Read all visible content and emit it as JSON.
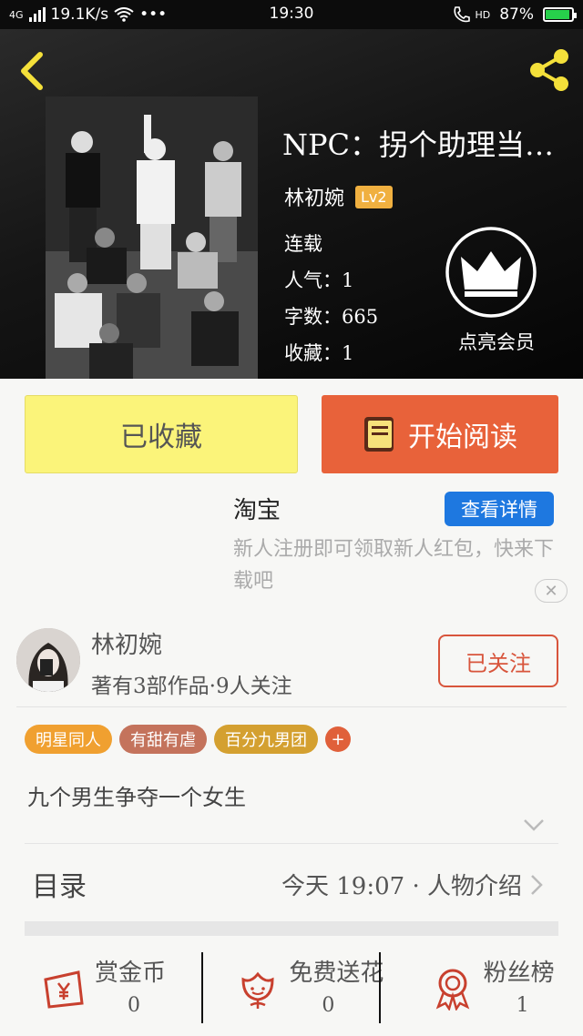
{
  "status_bar": {
    "network": "4G",
    "speed": "19.1K/s",
    "dots": "•••",
    "time": "19:30",
    "hd": "HD",
    "battery": "87%"
  },
  "book": {
    "title": "NPC：拐个助理当…",
    "author": "林初婉",
    "author_level": "Lv2",
    "status": "连载",
    "popularity": "人气：1",
    "word_count": "字数：665",
    "favorites": "收藏：1",
    "vip_label": "点亮会员"
  },
  "actions": {
    "collected_label": "已收藏",
    "read_label": "开始阅读"
  },
  "ad": {
    "title": "淘宝",
    "button": "查看详情",
    "description": "新人注册即可领取新人红包，快来下载吧",
    "close": "✕"
  },
  "author_card": {
    "name": "林初婉",
    "info": "著有3部作品·9人关注",
    "follow_label": "已关注"
  },
  "tags": [
    {
      "label": "明星同人",
      "color": "#f0a030"
    },
    {
      "label": "有甜有虐",
      "color": "#c4735c"
    },
    {
      "label": "百分九男团",
      "color": "#d4a030"
    }
  ],
  "tag_add": "+",
  "summary": "九个男生争夺一个女生",
  "catalog": {
    "label": "目录",
    "latest": "今天 19:07 · 人物介绍"
  },
  "bottom_bar": [
    {
      "icon": "coin-reward-icon",
      "label": "赏金币",
      "count": "0"
    },
    {
      "icon": "flower-icon",
      "label": "免费送花",
      "count": "0"
    },
    {
      "icon": "medal-ribbon-icon",
      "label": "粉丝榜",
      "count": "1"
    }
  ],
  "colors": {
    "accent_orange": "#e8623a",
    "collected_yellow": "#fbf47a",
    "ad_blue": "#1e78e0",
    "follow_red": "#d8553c",
    "icon_red": "#c8402e",
    "level_badge": "#f0b040"
  }
}
